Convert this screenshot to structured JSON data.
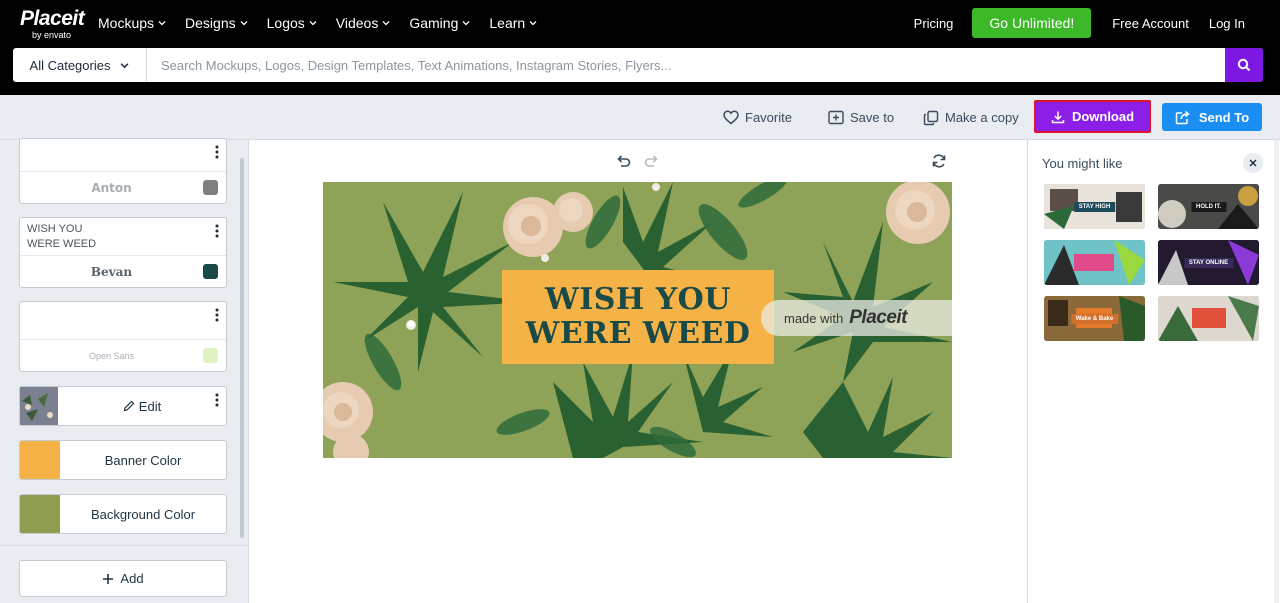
{
  "brand": {
    "name": "Placeit",
    "sub": "by envato"
  },
  "nav": [
    {
      "label": "Mockups"
    },
    {
      "label": "Designs"
    },
    {
      "label": "Logos"
    },
    {
      "label": "Videos"
    },
    {
      "label": "Gaming"
    },
    {
      "label": "Learn"
    }
  ],
  "header": {
    "pricing": "Pricing",
    "go_unlimited": "Go Unlimited!",
    "free_account": "Free Account",
    "login": "Log In"
  },
  "search": {
    "category": "All Categories",
    "placeholder": "Search Mockups, Logos, Design Templates, Text Animations, Instagram Stories, Flyers..."
  },
  "toolbar": {
    "favorite": "Favorite",
    "save_to": "Save to",
    "make_copy": "Make a copy",
    "download": "Download",
    "send_to": "Send To"
  },
  "layers": {
    "layer1": {
      "font": "Anton",
      "color": "#808080"
    },
    "layer2": {
      "line1": "WISH YOU",
      "line2": "WERE WEED",
      "font": "Bevan",
      "color": "#1a4a47"
    },
    "layer3": {
      "font": "Open Sans",
      "color": "#dff2c2"
    },
    "image_layer": {
      "edit_label": "Edit"
    },
    "banner_color": {
      "label": "Banner Color",
      "color": "#f5b247"
    },
    "background_color": {
      "label": "Background Color",
      "color": "#8f9d50"
    },
    "add_label": "Add"
  },
  "design": {
    "line1": "WISH YOU",
    "line2": "WERE WEED",
    "watermark_pre": "made with",
    "watermark_brand": "Placeit"
  },
  "suggestions": {
    "title": "You might like",
    "items": [
      {
        "label": "STAY HIGH",
        "bg": "#1f4a5a",
        "accent": "#2ab3c7"
      },
      {
        "label": "HOLD IT.",
        "bg": "#3a3a3a",
        "accent": "#d8a33a"
      },
      {
        "label": "",
        "bg": "#6fc3c7",
        "accent": "#e24b8a"
      },
      {
        "label": "STAY ONLINE",
        "bg": "#2a1a3a",
        "accent": "#8b3ad8"
      },
      {
        "label": "Wake & Bake",
        "bg": "#7a5a2a",
        "accent": "#e47a2a"
      },
      {
        "label": "",
        "bg": "#5a6a4a",
        "accent": "#e0503a"
      }
    ]
  }
}
